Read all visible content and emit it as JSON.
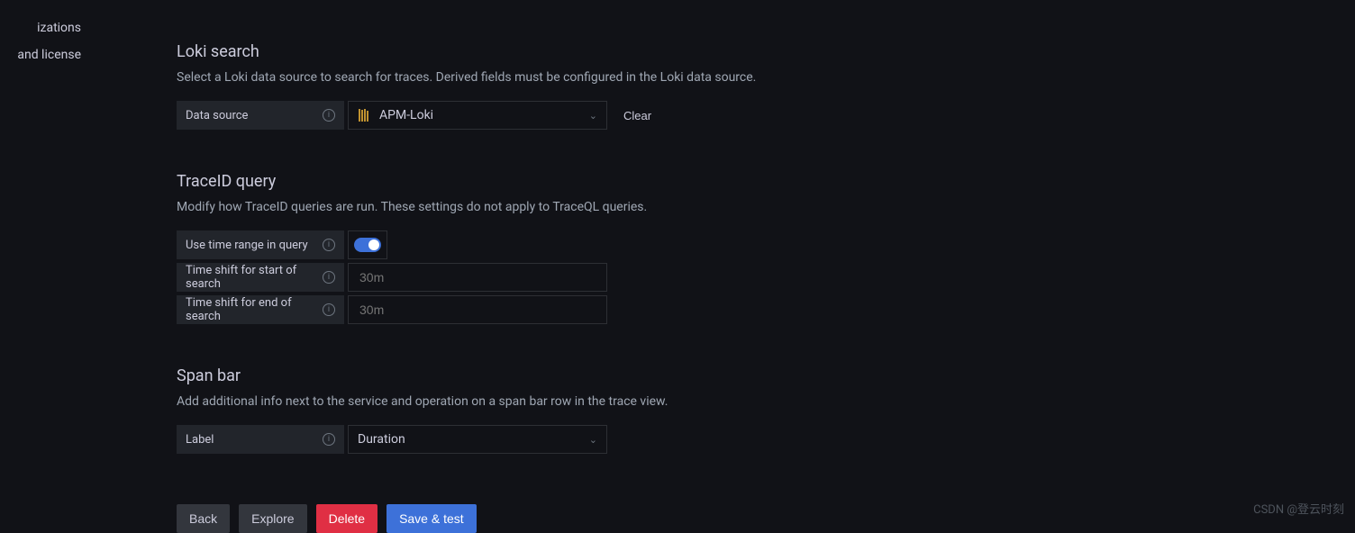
{
  "sidebar": {
    "items": [
      {
        "label": "izations"
      },
      {
        "label": "and license"
      }
    ]
  },
  "loki_search": {
    "title": "Loki search",
    "description": "Select a Loki data source to search for traces. Derived fields must be configured in the Loki data source.",
    "data_source_label": "Data source",
    "data_source_value": "APM-Loki",
    "clear_label": "Clear"
  },
  "traceid_query": {
    "title": "TraceID query",
    "description": "Modify how TraceID queries are run. These settings do not apply to TraceQL queries.",
    "use_time_range_label": "Use time range in query",
    "use_time_range_value": true,
    "time_shift_start_label": "Time shift for start of search",
    "time_shift_start_placeholder": "30m",
    "time_shift_end_label": "Time shift for end of search",
    "time_shift_end_placeholder": "30m"
  },
  "span_bar": {
    "title": "Span bar",
    "description": "Add additional info next to the service and operation on a span bar row in the trace view.",
    "label_label": "Label",
    "label_value": "Duration"
  },
  "buttons": {
    "back": "Back",
    "explore": "Explore",
    "delete": "Delete",
    "save_test": "Save & test"
  },
  "watermark": "CSDN @登云时刻"
}
